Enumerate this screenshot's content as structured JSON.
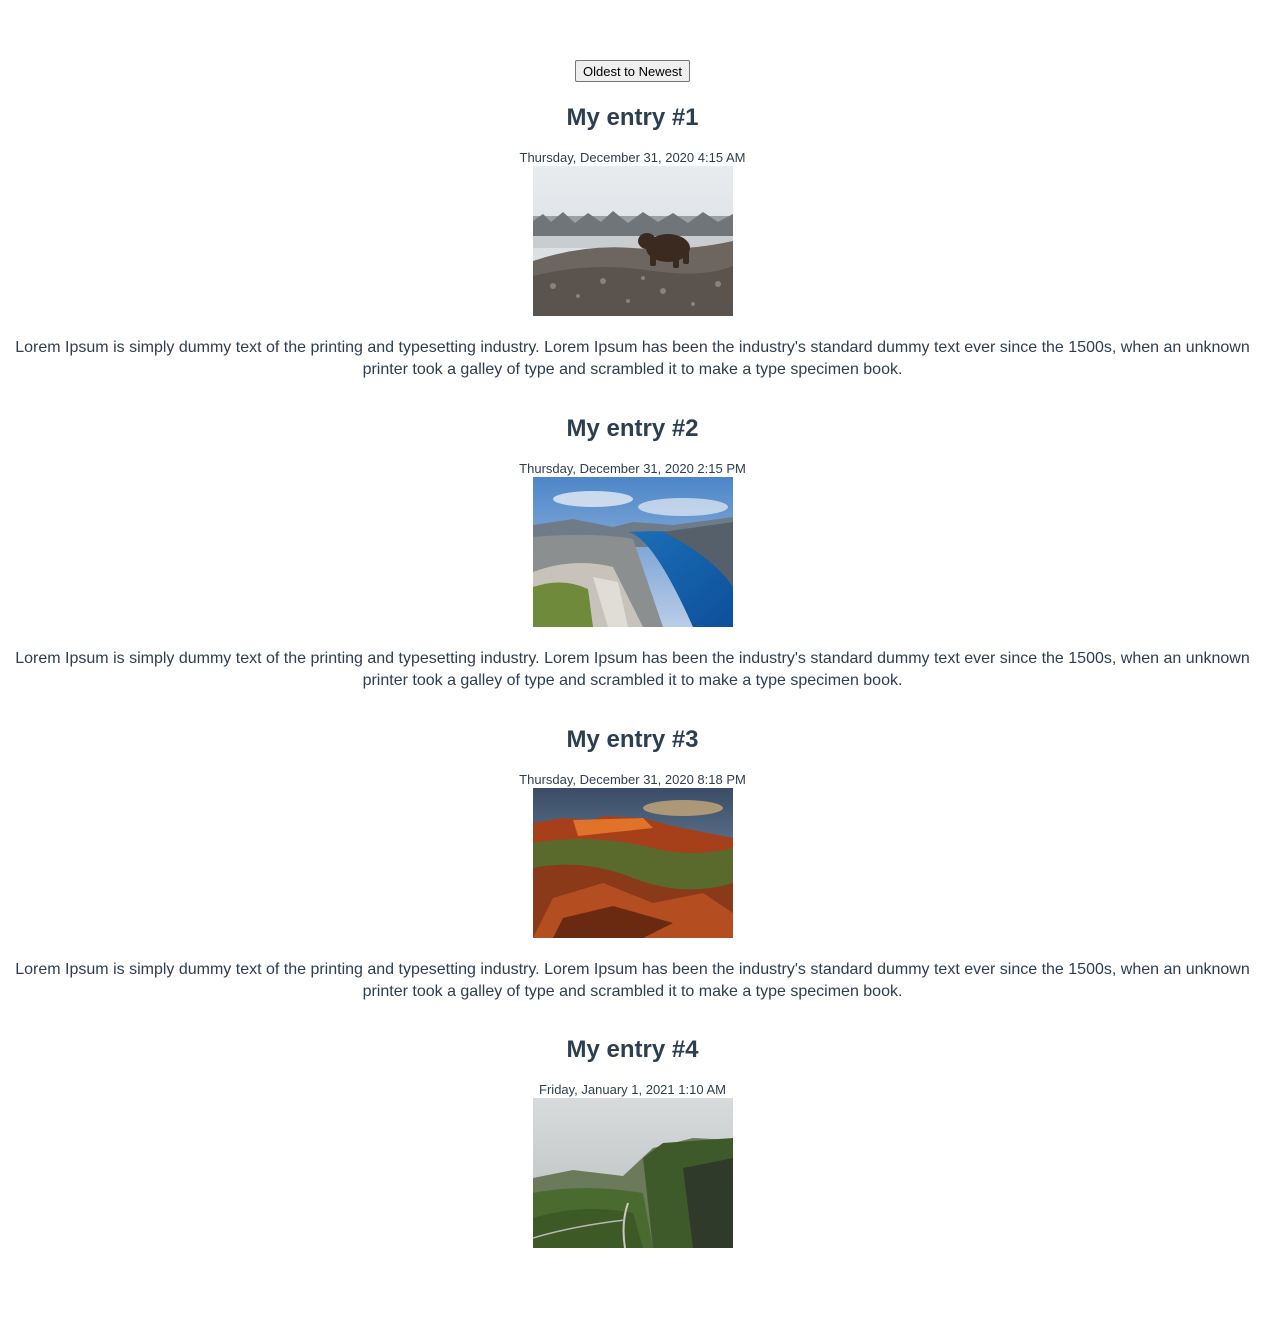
{
  "toolbar": {
    "sort_label": "Oldest to Newest"
  },
  "entries": [
    {
      "title": "My entry #1",
      "date": "Thursday, December 31, 2020 4:15 AM",
      "image": "bear-on-rocky-hill-photo",
      "text": "Lorem Ipsum is simply dummy text of the printing and typesetting industry. Lorem Ipsum has been the industry's standard dummy text ever since the 1500s, when an unknown printer took a galley of type and scrambled it to make a type specimen book."
    },
    {
      "title": "My entry #2",
      "date": "Thursday, December 31, 2020 2:15 PM",
      "image": "fjord-cliff-photo",
      "text": "Lorem Ipsum is simply dummy text of the printing and typesetting industry. Lorem Ipsum has been the industry's standard dummy text ever since the 1500s, when an unknown printer took a galley of type and scrambled it to make a type specimen book."
    },
    {
      "title": "My entry #3",
      "date": "Thursday, December 31, 2020 8:18 PM",
      "image": "red-canyon-sunset-photo",
      "text": "Lorem Ipsum is simply dummy text of the printing and typesetting industry. Lorem Ipsum has been the industry's standard dummy text ever since the 1500s, when an unknown printer took a galley of type and scrambled it to make a type specimen book."
    },
    {
      "title": "My entry #4",
      "date": "Friday, January 1, 2021 1:10 AM",
      "image": "green-highlands-road-photo",
      "text": ""
    }
  ]
}
